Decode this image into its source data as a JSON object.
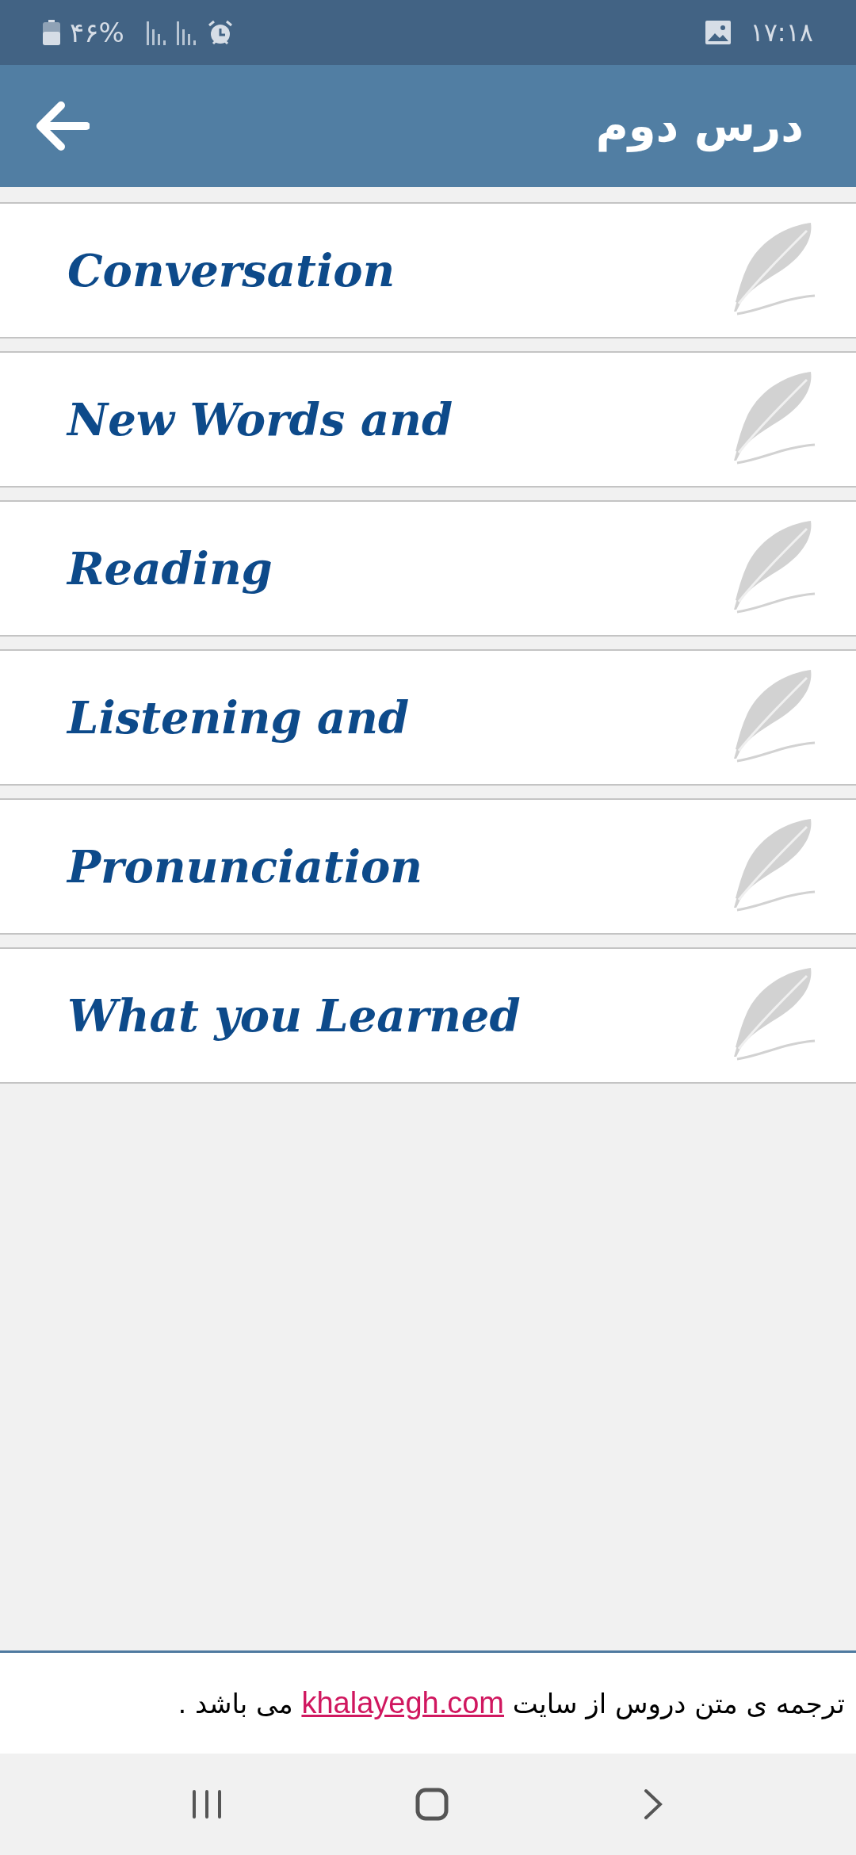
{
  "status_bar": {
    "battery": "۴۶%",
    "time": "۱۷:۱۸"
  },
  "header": {
    "title": "درس دوم"
  },
  "lessons": [
    {
      "title": "Conversation"
    },
    {
      "title": "New Words and"
    },
    {
      "title": "Reading"
    },
    {
      "title": "Listening and"
    },
    {
      "title": "Pronunciation"
    },
    {
      "title": "What you Learned"
    }
  ],
  "footer": {
    "before": "ترجمه ی متن دروس از سایت",
    "link": "khalayegh.com",
    "after": "می باشد ."
  }
}
